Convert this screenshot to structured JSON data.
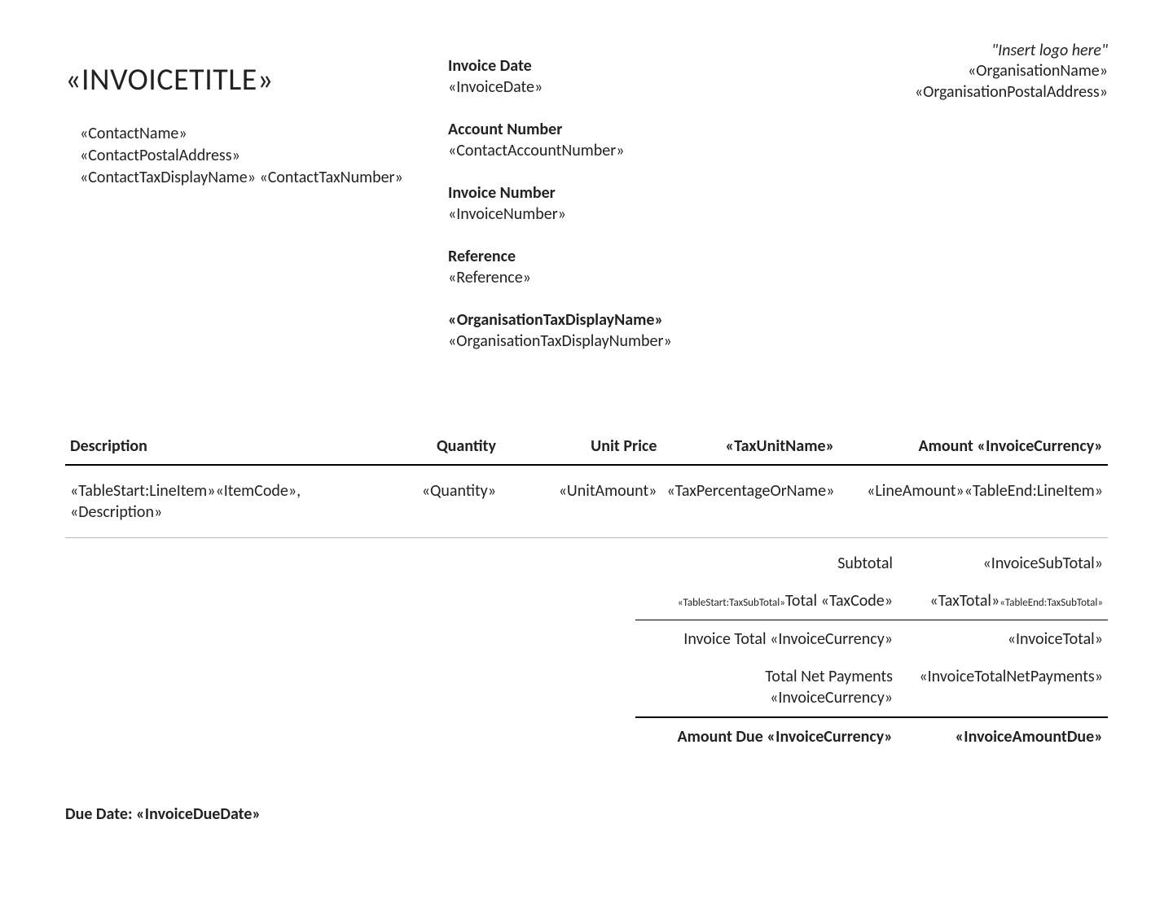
{
  "header": {
    "title": "«INVOICETITLE»",
    "logo_hint": "\"Insert logo here\"",
    "org_name": "«OrganisationName»",
    "org_address": "«OrganisationPostalAddress»"
  },
  "contact": {
    "name": "«ContactName»",
    "address": "«ContactPostalAddress»",
    "tax_line": "«ContactTaxDisplayName» «ContactTaxNumber»"
  },
  "meta": {
    "invoice_date_label": "Invoice Date",
    "invoice_date": "«InvoiceDate»",
    "account_number_label": "Account Number",
    "account_number": "«ContactAccountNumber»",
    "invoice_number_label": "Invoice Number",
    "invoice_number": "«InvoiceNumber»",
    "reference_label": "Reference",
    "reference": "«Reference»",
    "org_tax_label": "«OrganisationTaxDisplayName»",
    "org_tax_number": "«OrganisationTaxDisplayNumber»"
  },
  "table": {
    "headers": {
      "description": "Description",
      "quantity": "Quantity",
      "unit_price": "Unit Price",
      "tax": "«TaxUnitName»",
      "amount": "Amount «InvoiceCurrency»"
    },
    "row": {
      "description": "«TableStart:LineItem»«ItemCode», «Description»",
      "quantity": "«Quantity»",
      "unit_amount": "«UnitAmount»",
      "tax": "«TaxPercentageOrName»",
      "amount": "«LineAmount»«TableEnd:LineItem»"
    }
  },
  "totals": {
    "subtotal_label": "Subtotal",
    "subtotal_value": "«InvoiceSubTotal»",
    "tax_label_prefix": "«TableStart:TaxSubTotal»",
    "tax_label": "Total «TaxCode»",
    "tax_value": "«TaxTotal»",
    "tax_value_suffix": "«TableEnd:TaxSubTotal»",
    "invoice_total_label": "Invoice Total «InvoiceCurrency»",
    "invoice_total_value": "«InvoiceTotal»",
    "net_payments_label": "Total Net Payments «InvoiceCurrency»",
    "net_payments_value": "«InvoiceTotalNetPayments»",
    "amount_due_label": "Amount Due «InvoiceCurrency»",
    "amount_due_value": "«InvoiceAmountDue»"
  },
  "footer": {
    "due_date_label": "Due Date: ",
    "due_date_value": "«InvoiceDueDate»"
  }
}
